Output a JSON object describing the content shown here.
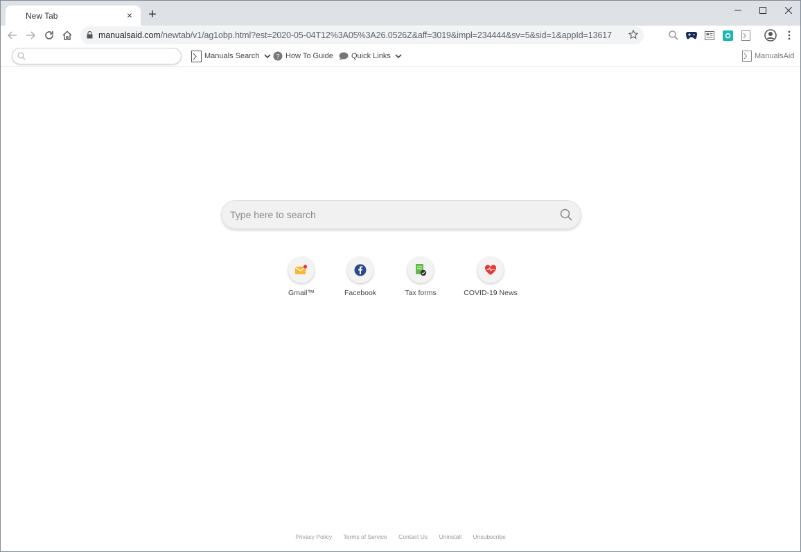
{
  "tab": {
    "title": "New Tab",
    "close": "×",
    "new_tab": "+"
  },
  "window_controls": {
    "minimize": "–",
    "maximize": "□",
    "close": "×"
  },
  "address_bar": {
    "domain": "manualsaid.com",
    "path": "/newtab/v1/ag1obp.html?est=2020-05-04T12%3A05%3A26.0526Z&aff=3019&impl=234444&sv=5&sid=1&appId=13617"
  },
  "extension_bar": {
    "manuals_search": "Manuals Search",
    "how_to_guide": "How To Guide",
    "quick_links": "Quick Links",
    "brand": "ManualsAid"
  },
  "search": {
    "placeholder": "Type here to search"
  },
  "tiles": [
    {
      "label": "Gmail™"
    },
    {
      "label": "Facebook"
    },
    {
      "label": "Tax forms"
    },
    {
      "label": "COVID-19 News"
    }
  ],
  "footer": {
    "privacy": "Privacy Policy",
    "terms": "Terms of Service",
    "contact": "Contact Us",
    "uninstall": "Uninstall",
    "unsubscribe": "Unsubscribe"
  },
  "colors": {
    "tabstrip": "#dee1e6",
    "omnibox": "#f1f3f4",
    "accent_teal": "#1fb5b0"
  }
}
